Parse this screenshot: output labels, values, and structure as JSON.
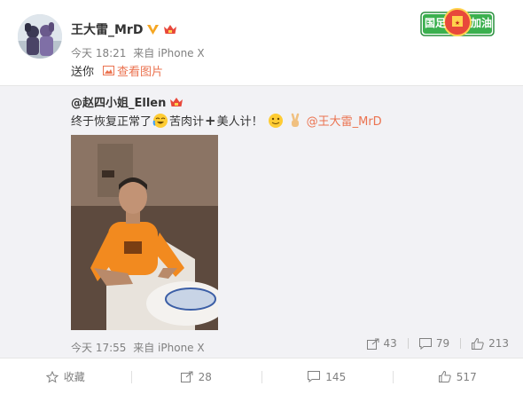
{
  "post": {
    "author": "王大雷_MrD",
    "time": "今天 18:21",
    "source": "来自 iPhone X",
    "text": "送你",
    "view_pic": "查看图片"
  },
  "badge": {
    "text_left": "国足",
    "text_right": "加油"
  },
  "repost": {
    "author": "@赵四小姐_Ellen",
    "text_part1": "终于恢复正常了",
    "text_part2": "苦肉计",
    "plus": "+",
    "text_part3": "美人计！",
    "mention": "@王大雷_MrD",
    "time": "今天 17:55",
    "source": "来自 iPhone X",
    "forward_count": "43",
    "comment_count": "79",
    "like_count": "213"
  },
  "bottom": {
    "favorite": "收藏",
    "forward": "28",
    "comment": "145",
    "like": "517"
  },
  "colors": {
    "accent": "#eb7350",
    "repost_bg": "#f2f2f5",
    "vip": "#f5a623"
  }
}
